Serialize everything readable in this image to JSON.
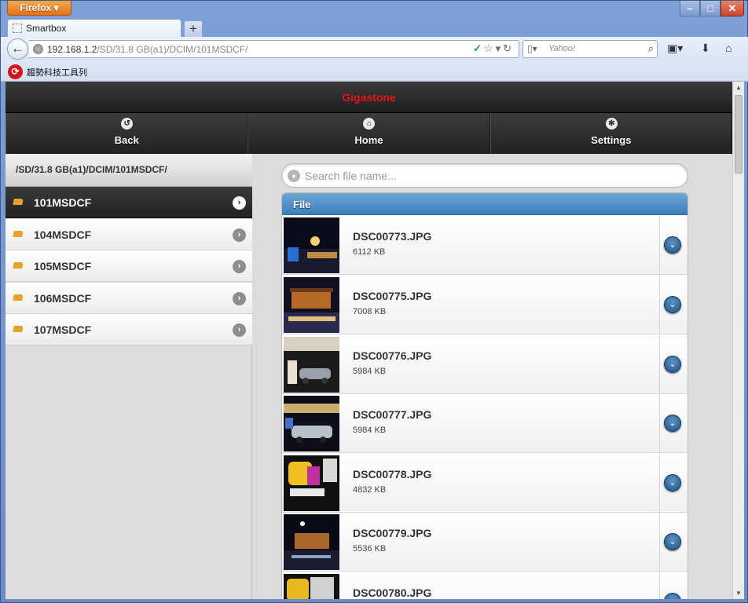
{
  "browser": {
    "menu_button": "Firefox ▾",
    "tab_title": "Smartbox",
    "new_tab": "+",
    "url_host": "192.168.1.2",
    "url_path": "/SD/31.8 GB(a1)/DCIM/101MSDCF/",
    "search_placeholder": "Yahoo!",
    "toolbar_label": "趨勢科技工具列",
    "window_controls": {
      "minimize": "–",
      "maximize": "□",
      "close": "✕"
    }
  },
  "app": {
    "brand": "Gigastone",
    "nav": [
      {
        "label": "Back",
        "icon": "back-arrow-icon"
      },
      {
        "label": "Home",
        "icon": "home-icon"
      },
      {
        "label": "Settings",
        "icon": "gear-icon"
      }
    ],
    "path": "/SD/31.8 GB(a1)/DCIM/101MSDCF/",
    "folders": [
      {
        "name": "101MSDCF",
        "active": true
      },
      {
        "name": "104MSDCF",
        "active": false
      },
      {
        "name": "105MSDCF",
        "active": false
      },
      {
        "name": "106MSDCF",
        "active": false
      },
      {
        "name": "107MSDCF",
        "active": false
      }
    ],
    "search_placeholder": "Search file name...",
    "file_header": "File",
    "files": [
      {
        "name": "DSC00773.JPG",
        "size": "6112 KB"
      },
      {
        "name": "DSC00775.JPG",
        "size": "7008 KB"
      },
      {
        "name": "DSC00776.JPG",
        "size": "5984 KB"
      },
      {
        "name": "DSC00777.JPG",
        "size": "5984 KB"
      },
      {
        "name": "DSC00778.JPG",
        "size": "4832 KB"
      },
      {
        "name": "DSC00779.JPG",
        "size": "5536 KB"
      },
      {
        "name": "DSC00780.JPG",
        "size": ""
      }
    ]
  },
  "colors": {
    "brand": "#e8141a",
    "accent": "#3c7fba"
  }
}
